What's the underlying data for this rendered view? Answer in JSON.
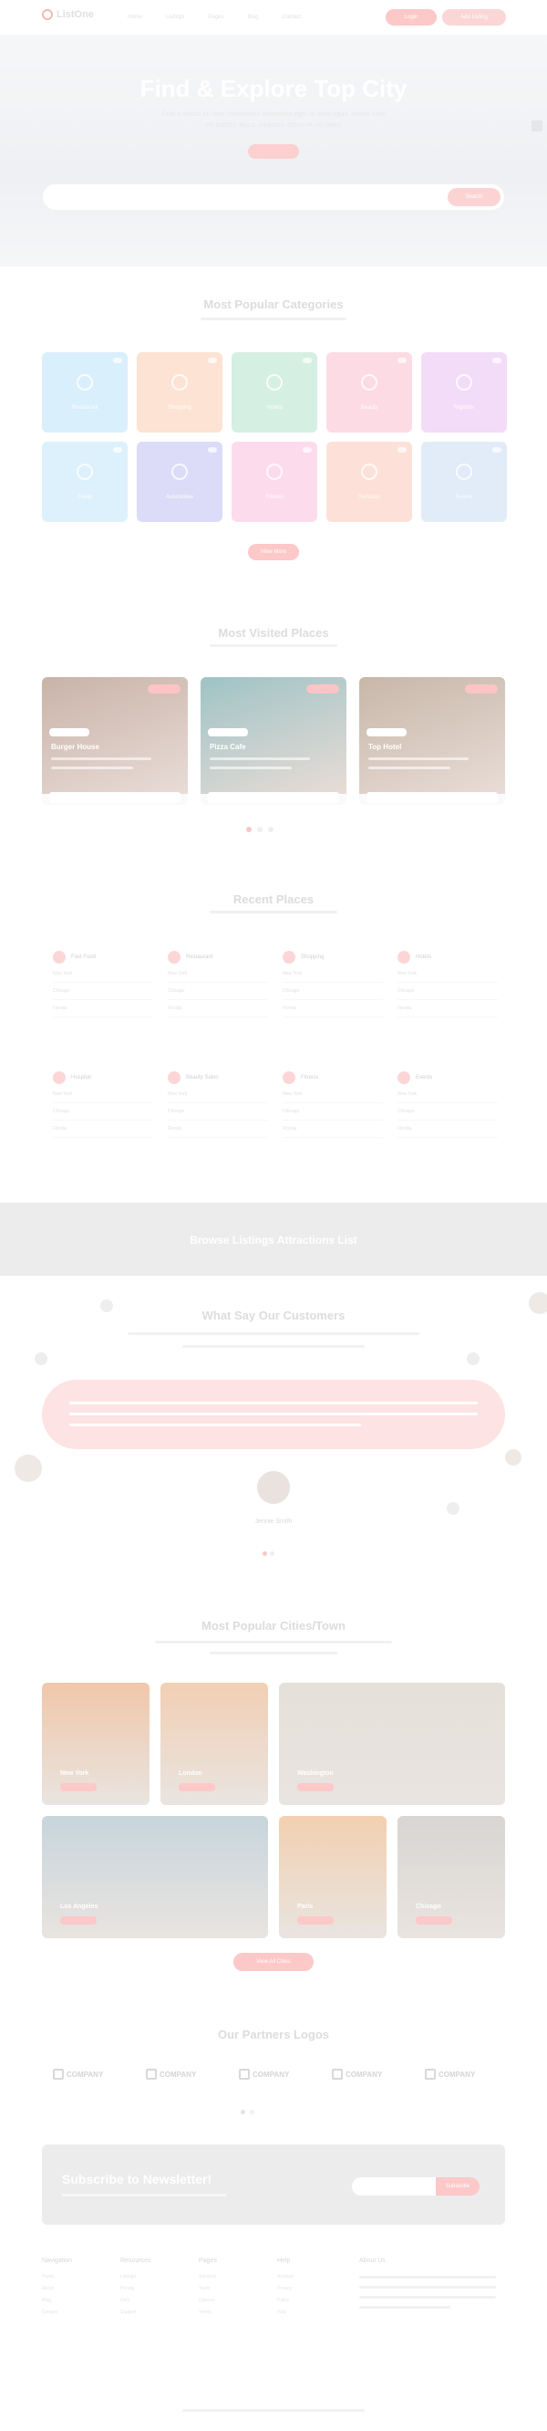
{
  "header": {
    "logo": "ListOne",
    "nav": [
      "Home",
      "Listings",
      "Pages",
      "Blog",
      "Contact"
    ],
    "btn_a": "Login",
    "btn_b": "Add Listing"
  },
  "hero": {
    "title": "Find & Explore Top City",
    "subtitle_1": "Cras a massa eu nunc consectetur fermentum eget sit amet ligula, nullam vitae",
    "subtitle_2": "elit porttitor lectus venenatis dictum et nec tellus",
    "search_button": "Search"
  },
  "categories": {
    "title": "Most Popular Categories",
    "items": [
      {
        "label": "Restaurant",
        "color": "#d9effb"
      },
      {
        "label": "Shopping",
        "color": "#fde3d3"
      },
      {
        "label": "Hotels",
        "color": "#d6efe3"
      },
      {
        "label": "Beauty",
        "color": "#fcdbe5"
      },
      {
        "label": "Nightlife",
        "color": "#f3dcf7"
      },
      {
        "label": "Travel",
        "color": "#dcf1fb"
      },
      {
        "label": "Automotive",
        "color": "#dcdcf8"
      },
      {
        "label": "Fitness",
        "color": "#fcdcec"
      },
      {
        "label": "Services",
        "color": "#fde1d8"
      },
      {
        "label": "Events",
        "color": "#e1ecf8"
      }
    ],
    "more_button": "View More"
  },
  "visited": {
    "title": "Most Visited Places",
    "cards": [
      {
        "name": "Burger House",
        "color": "#c9b3a9"
      },
      {
        "name": "Pizza Cafe",
        "color": "#9fc3c5"
      },
      {
        "name": "Top Hotel",
        "color": "#c8b7a9"
      }
    ]
  },
  "recent": {
    "title": "Recent Places",
    "columns": [
      {
        "head": "Fast Food",
        "rows": [
          "New York",
          "Chicago",
          "Florida"
        ]
      },
      {
        "head": "Restaurant",
        "rows": [
          "New York",
          "Chicago",
          "Florida"
        ]
      },
      {
        "head": "Shopping",
        "rows": [
          "New York",
          "Chicago",
          "Florida"
        ]
      },
      {
        "head": "Hotels",
        "rows": [
          "New York",
          "Chicago",
          "Florida"
        ]
      },
      {
        "head": "Hospital",
        "rows": [
          "New York",
          "Chicago",
          "Florida"
        ]
      },
      {
        "head": "Beauty Salon",
        "rows": [
          "New York",
          "Chicago",
          "Florida"
        ]
      },
      {
        "head": "Fitness",
        "rows": [
          "New York",
          "Chicago",
          "Florida"
        ]
      },
      {
        "head": "Events",
        "rows": [
          "New York",
          "Chicago",
          "Florida"
        ]
      }
    ]
  },
  "banner": {
    "text": "Browse Listings Attractions List"
  },
  "testimonials": {
    "title": "What Say Our Customers",
    "name": "Jennie Smith"
  },
  "cities": {
    "title": "Most Popular Cities/Town",
    "items": [
      {
        "name": "New York",
        "count": "12 Listings",
        "color": "#f0c7a9"
      },
      {
        "name": "London",
        "count": "10 Listings",
        "color": "#f2cfb4"
      },
      {
        "name": "Washington",
        "count": "08 Listings",
        "color": "#e6e0da"
      },
      {
        "name": "Los Angeles",
        "count": "15 Listings",
        "color": "#c7d5dc"
      },
      {
        "name": "Paris",
        "count": "09 Listings",
        "color": "#f2d0b0"
      },
      {
        "name": "Chicago",
        "count": "11 Listings",
        "color": "#d8d5d2"
      }
    ],
    "more_button": "View All Cities"
  },
  "partners": {
    "title": "Our Partners Logos",
    "logos": [
      "COMPANY",
      "COMPANY",
      "COMPANY",
      "COMPANY",
      "COMPANY"
    ]
  },
  "newsletter": {
    "title": "Subscribe to Newsletter!",
    "button": "Subscribe"
  },
  "footer": {
    "columns": [
      {
        "head": "Navigation",
        "links": [
          "Home",
          "About",
          "Blog",
          "Contact"
        ]
      },
      {
        "head": "Resources",
        "links": [
          "Listings",
          "Pricing",
          "FAQ",
          "Support"
        ]
      },
      {
        "head": "Pages",
        "links": [
          "Services",
          "Team",
          "Careers",
          "Terms"
        ]
      },
      {
        "head": "Help",
        "links": [
          "Account",
          "Privacy",
          "Policy",
          "Help"
        ]
      },
      {
        "head": "About Us",
        "links": []
      }
    ]
  }
}
